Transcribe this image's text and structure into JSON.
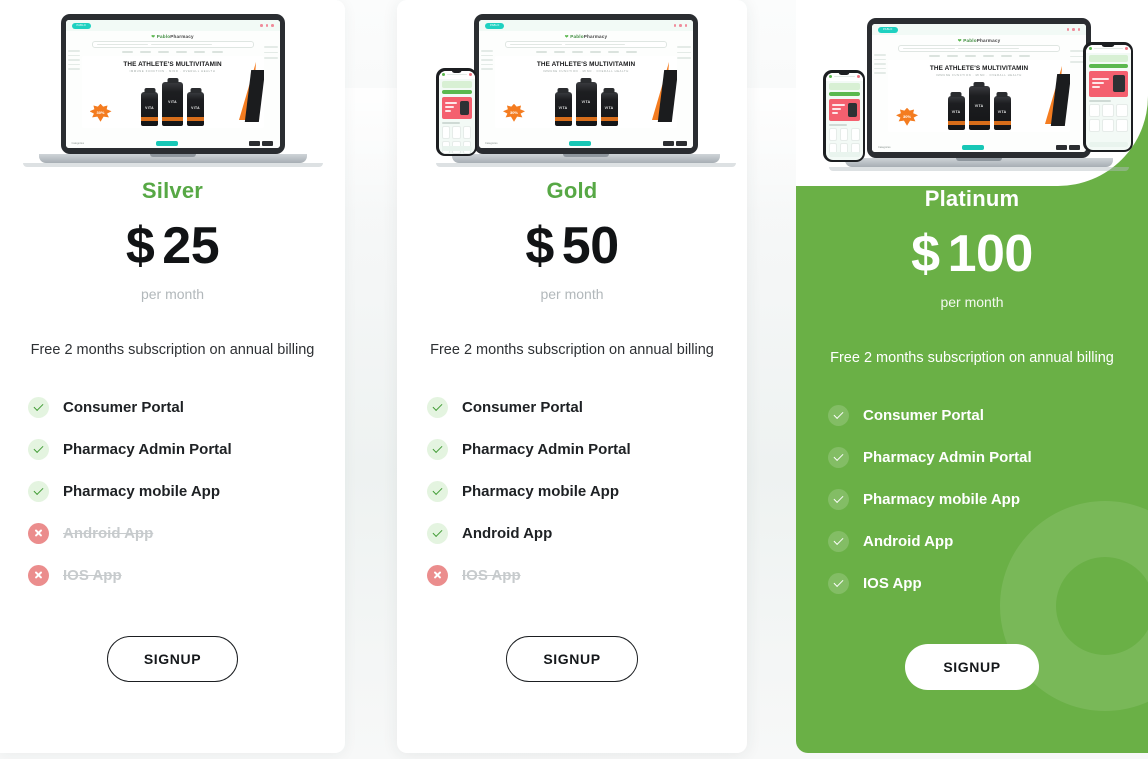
{
  "page": {
    "background_color": "#f6f7f8",
    "accent_green": "#57a845",
    "platinum_card_color": "#6ab046",
    "check_color": "#3f9b33",
    "cross_color": "#eb8d8d"
  },
  "device_preview": {
    "site_badge": "PABLO",
    "brand_primary": "Pablo",
    "brand_secondary": "Pharmacy",
    "banner_title": "THE ATHLETE'S MULTIVITAMIN",
    "banner_subtitle": "IMMUNE FUNCTION  ·  MIND  ·  OVERALL HEALTH",
    "bottle_label": "VITA",
    "discount_badge": "30%",
    "category_label": "Categories"
  },
  "plans": [
    {
      "id": "silver",
      "name": "Silver",
      "currency": "$",
      "amount": "25",
      "period": "per month",
      "billing_note": "Free 2 months subscription on annual billing",
      "cta": "SIGNUP",
      "features": [
        {
          "label": "Consumer Portal",
          "included": true
        },
        {
          "label": "Pharmacy Admin Portal",
          "included": true
        },
        {
          "label": "Pharmacy mobile App",
          "included": true
        },
        {
          "label": "Android App",
          "included": false
        },
        {
          "label": "IOS App",
          "included": false
        }
      ]
    },
    {
      "id": "gold",
      "name": "Gold",
      "currency": "$",
      "amount": "50",
      "period": "per month",
      "billing_note": "Free 2 months subscription on annual billing",
      "cta": "SIGNUP",
      "features": [
        {
          "label": "Consumer Portal",
          "included": true
        },
        {
          "label": "Pharmacy Admin Portal",
          "included": true
        },
        {
          "label": "Pharmacy mobile App",
          "included": true
        },
        {
          "label": "Android App",
          "included": true
        },
        {
          "label": "IOS App",
          "included": false
        }
      ]
    },
    {
      "id": "platinum",
      "name": "Platinum",
      "currency": "$",
      "amount": "100",
      "period": "per month",
      "billing_note": "Free 2 months subscription on annual billing",
      "cta": "SIGNUP",
      "features": [
        {
          "label": "Consumer Portal",
          "included": true
        },
        {
          "label": "Pharmacy Admin Portal",
          "included": true
        },
        {
          "label": "Pharmacy mobile App",
          "included": true
        },
        {
          "label": "Android App",
          "included": true
        },
        {
          "label": "IOS App",
          "included": true
        }
      ]
    }
  ]
}
